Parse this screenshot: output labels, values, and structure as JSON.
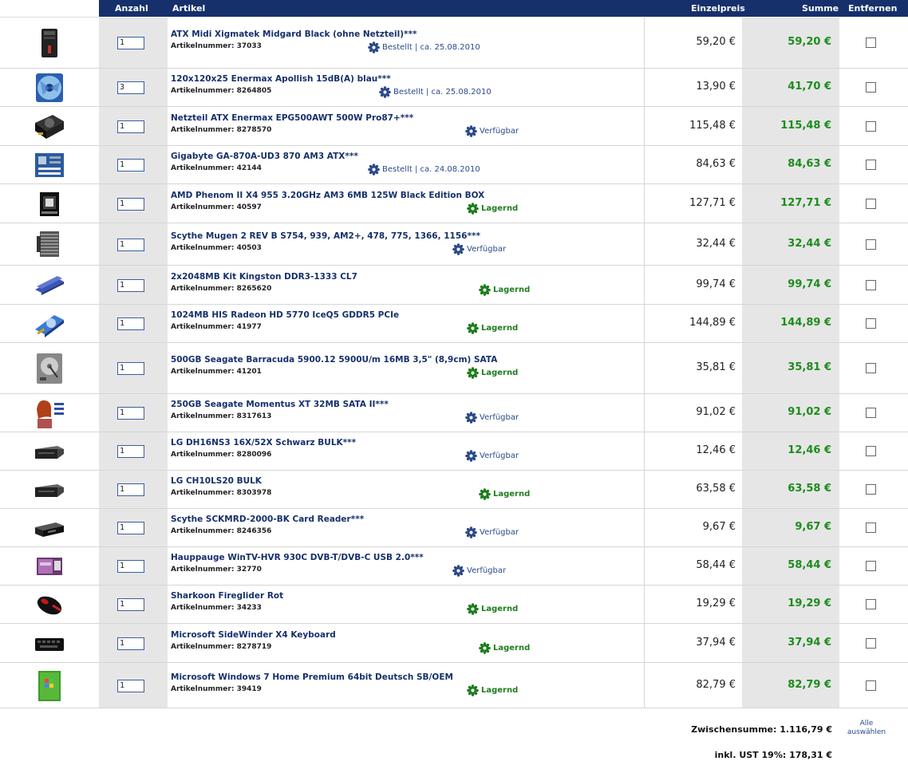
{
  "header": {
    "anzahl": "Anzahl",
    "artikel": "Artikel",
    "einzelpreis": "Einzelpreis",
    "summe": "Summe",
    "entfernen": "Entfernen"
  },
  "colors": {
    "header_bg": "#16306b",
    "sum_green": "#1d8c1d",
    "status_blue": "#2c4a8a",
    "status_green": "#1d7d1d"
  },
  "items": [
    {
      "icon": "pc-case-icon",
      "qty": "1",
      "name": "ATX Midi Xigmatek Midgard Black (ohne Netzteil)***",
      "artnr": "Artikelnummer: 37033",
      "status": "Bestellt | ca. 25.08.2010",
      "status_type": "blue",
      "price": "59,20 €",
      "sum": "59,20 €"
    },
    {
      "icon": "case-fan-icon",
      "qty": "3",
      "name": "120x120x25 Enermax Apollish 15dB(A) blau***",
      "artnr": "Artikelnummer: 8264805",
      "status": "Bestellt | ca. 25.08.2010",
      "status_type": "blue",
      "price": "13,90 €",
      "sum": "41,70 €"
    },
    {
      "icon": "power-supply-icon",
      "qty": "1",
      "name": "Netzteil ATX Enermax EPG500AWT 500W Pro87+***",
      "artnr": "Artikelnummer: 8278570",
      "status": "Verfügbar",
      "status_type": "blue",
      "price": "115,48 €",
      "sum": "115,48 €"
    },
    {
      "icon": "mainboard-icon",
      "qty": "1",
      "name": "Gigabyte GA-870A-UD3 870 AM3 ATX***",
      "artnr": "Artikelnummer: 42144",
      "status": "Bestellt | ca. 24.08.2010",
      "status_type": "blue",
      "price": "84,63 €",
      "sum": "84,63 €"
    },
    {
      "icon": "cpu-box-icon",
      "qty": "1",
      "name": "AMD Phenom II X4 955 3.20GHz AM3 6MB 125W Black Edition BOX",
      "artnr": "Artikelnummer: 40597",
      "status": "Lagernd",
      "status_type": "green",
      "price": "127,71 €",
      "sum": "127,71 €"
    },
    {
      "icon": "cpu-cooler-icon",
      "qty": "1",
      "name": "Scythe Mugen 2 REV B S754, 939, AM2+, 478, 775, 1366, 1156***",
      "artnr": "Artikelnummer: 40503",
      "status": "Verfügbar",
      "status_type": "blue",
      "price": "32,44 €",
      "sum": "32,44 €"
    },
    {
      "icon": "ram-icon",
      "qty": "1",
      "name": "2x2048MB Kit Kingston DDR3-1333 CL7",
      "artnr": "Artikelnummer: 8265620",
      "status": "Lagernd",
      "status_type": "green",
      "price": "99,74 €",
      "sum": "99,74 €"
    },
    {
      "icon": "graphics-card-icon",
      "qty": "1",
      "name": "1024MB HIS Radeon HD 5770 IceQ5 GDDR5 PCIe",
      "artnr": "Artikelnummer: 41977",
      "status": "Lagernd",
      "status_type": "green",
      "price": "144,89 €",
      "sum": "144,89 €"
    },
    {
      "icon": "hard-drive-icon",
      "qty": "1",
      "name": "500GB Seagate Barracuda 5900.12 5900U/m 16MB 3,5\" (8,9cm) SATA",
      "artnr": "Artikelnummer: 41201",
      "status": "Lagernd",
      "status_type": "green",
      "price": "35,81 €",
      "sum": "35,81 €"
    },
    {
      "icon": "product-photo-icon",
      "qty": "1",
      "name": "250GB Seagate Momentus XT 32MB SATA II***",
      "artnr": "Artikelnummer: 8317613",
      "status": "Verfügbar",
      "status_type": "blue",
      "price": "91,02 €",
      "sum": "91,02 €"
    },
    {
      "icon": "optical-drive-icon",
      "qty": "1",
      "name": "LG DH16NS3 16X/52X Schwarz BULK***",
      "artnr": "Artikelnummer: 8280096",
      "status": "Verfügbar",
      "status_type": "blue",
      "price": "12,46 €",
      "sum": "12,46 €"
    },
    {
      "icon": "optical-drive-icon",
      "qty": "1",
      "name": "LG CH10LS20 BULK",
      "artnr": "Artikelnummer: 8303978",
      "status": "Lagernd",
      "status_type": "green",
      "price": "63,58 €",
      "sum": "63,58 €"
    },
    {
      "icon": "card-reader-icon",
      "qty": "1",
      "name": "Scythe SCKMRD-2000-BK Card Reader***",
      "artnr": "Artikelnummer: 8246356",
      "status": "Verfügbar",
      "status_type": "blue",
      "price": "9,67 €",
      "sum": "9,67 €"
    },
    {
      "icon": "tv-tuner-box-icon",
      "qty": "1",
      "name": "Hauppauge WinTV-HVR 930C DVB-T/DVB-C USB 2.0***",
      "artnr": "Artikelnummer: 32770",
      "status": "Verfügbar",
      "status_type": "blue",
      "price": "58,44 €",
      "sum": "58,44 €"
    },
    {
      "icon": "mouse-icon",
      "qty": "1",
      "name": "Sharkoon Fireglider Rot",
      "artnr": "Artikelnummer: 34233",
      "status": "Lagernd",
      "status_type": "green",
      "price": "19,29 €",
      "sum": "19,29 €"
    },
    {
      "icon": "keyboard-icon",
      "qty": "1",
      "name": "Microsoft SideWinder X4 Keyboard",
      "artnr": "Artikelnummer: 8278719",
      "status": "Lagernd",
      "status_type": "green",
      "price": "37,94 €",
      "sum": "37,94 €"
    },
    {
      "icon": "software-box-icon",
      "qty": "1",
      "name": "Microsoft Windows 7 Home Premium 64bit Deutsch SB/OEM",
      "artnr": "Artikelnummer: 39419",
      "status": "Lagernd",
      "status_type": "green",
      "price": "82,79 €",
      "sum": "82,79 €"
    }
  ],
  "footer": {
    "subtotal": "Zwischensumme: 1.116,79 €",
    "vat": "inkl. UST 19%: 178,31 €",
    "select_all_line1": "Alle",
    "select_all_line2": "auswählen"
  }
}
